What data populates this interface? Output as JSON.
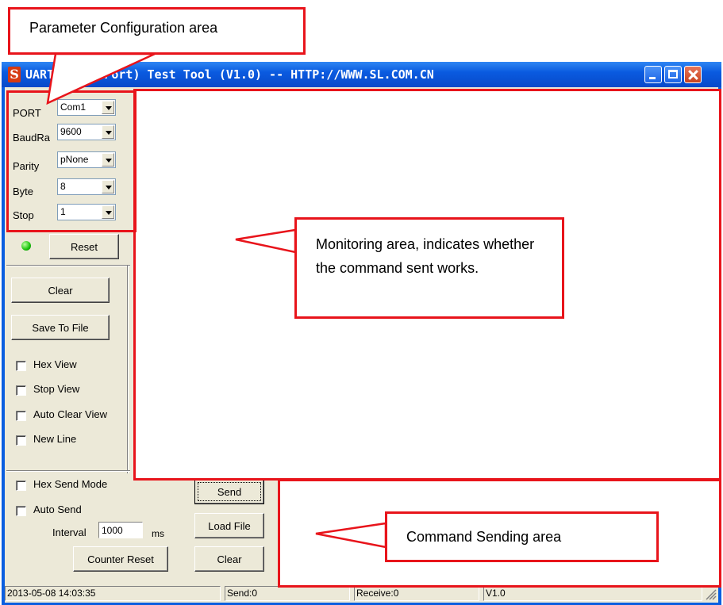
{
  "window": {
    "title": "UART(SerialPort) Test Tool (V1.0) -- HTTP://WWW.SL.COM.CN",
    "logo_letter": "S"
  },
  "params": [
    {
      "label": "PORT",
      "value": "Com1"
    },
    {
      "label": "BaudRa",
      "value": "9600"
    },
    {
      "label": "Parity",
      "value": "pNone"
    },
    {
      "label": "Byte",
      "value": "8"
    },
    {
      "label": "Stop",
      "value": "1"
    }
  ],
  "buttons": {
    "reset": "Reset",
    "clear": "Clear",
    "save_to_file": "Save To File",
    "send": "Send",
    "load_file": "Load File",
    "clear_send": "Clear",
    "counter_reset": "Counter Reset"
  },
  "checkboxes": {
    "hex_view": "Hex View",
    "stop_view": "Stop View",
    "auto_clear_view": "Auto Clear View",
    "new_line": "New Line",
    "hex_send_mode": "Hex Send Mode",
    "auto_send": "Auto Send"
  },
  "interval": {
    "label": "Interval",
    "value": "1000",
    "unit": "ms"
  },
  "status": {
    "datetime": "2013-05-08 14:03:35",
    "send": "Send:0",
    "receive": "Receive:0",
    "version": "V1.0"
  },
  "annotations": {
    "parameter": "Parameter Configuration area",
    "monitoring": "Monitoring area, indicates whether the command sent works.",
    "command": "Command Sending area"
  },
  "colors": {
    "annotation_red": "#e8141b",
    "titlebar_blue": "#0a5ee0",
    "led_green": "#19c20b"
  }
}
